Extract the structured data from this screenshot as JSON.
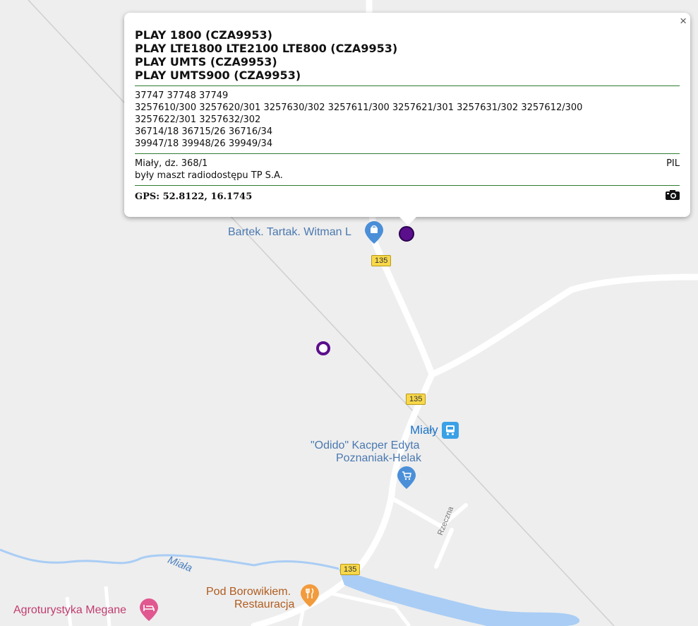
{
  "popup": {
    "operators": [
      "PLAY 1800 (CZA9953)",
      "PLAY LTE1800 LTE2100 LTE800 (CZA9953)",
      "PLAY UMTS (CZA9953)",
      "PLAY UMTS900 (CZA9953)"
    ],
    "ids": [
      "37747 37748 37749",
      "3257610/300 3257620/301 3257630/302 3257611/300 3257621/301 3257631/302 3257612/300",
      "3257622/301 3257632/302",
      "36714/18 36715/26 36716/34",
      "39947/18 39948/26 39949/34"
    ],
    "location": "Miały, dz. 368/1",
    "region": "PIL",
    "note": "były maszt radiodostępu TP S.A.",
    "gps": "GPS: 52.8122, 16.1745",
    "close": "×",
    "camera_icon": "camera-icon"
  },
  "map": {
    "labels": {
      "tartak": "Bartek. Tartak. Witman L",
      "mialy": "Miały",
      "odido1": "\"Odido\" Kacper Edyta",
      "odido2": "Poznaniak-Helak",
      "river": "Miała",
      "street": "Rzeczna",
      "restaurant1": "Pod Borowikiem.",
      "restaurant2": "Restauracja",
      "agro": "Agroturystyka Megane"
    },
    "road_number": "135",
    "colors": {
      "background": "#eeeeee",
      "road": "#ffffff",
      "water": "#a9cdf5",
      "marker": "#5b0f8c",
      "shield": "#f8d84a"
    }
  }
}
